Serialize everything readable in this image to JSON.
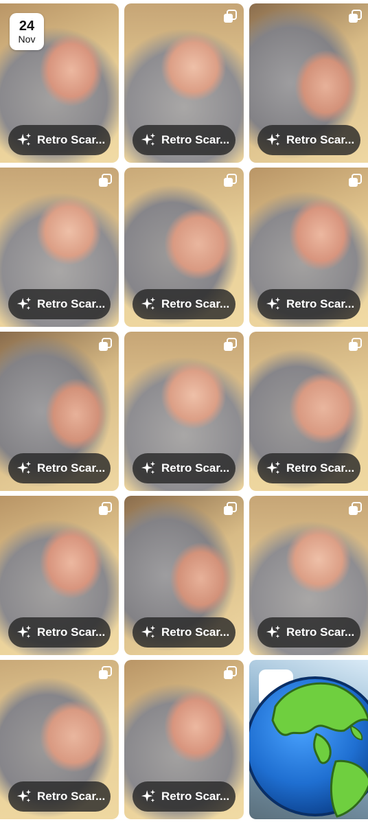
{
  "date_chip": {
    "day": "24",
    "month": "Nov"
  },
  "tiles": [
    {
      "label": "Retro Scar..."
    },
    {
      "label": "Retro Scar..."
    },
    {
      "label": "Retro Scar..."
    },
    {
      "label": "Retro Scar..."
    },
    {
      "label": "Retro Scar..."
    },
    {
      "label": "Retro Scar..."
    },
    {
      "label": "Retro Scar..."
    },
    {
      "label": "Retro Scar..."
    },
    {
      "label": "Retro Scar..."
    },
    {
      "label": "Retro Scar..."
    },
    {
      "label": "Retro Scar..."
    },
    {
      "label": "Retro Scar..."
    },
    {
      "label": "Retro Scar..."
    },
    {
      "label": "Retro Scar..."
    }
  ],
  "icons": {
    "stack": "stack-icon",
    "sparkle": "sparkle-icon",
    "globe": "globe-icon"
  },
  "colors": {
    "badge_bg": "#282828",
    "badge_text": "#ffffff",
    "globe_ocean": "#1f6fd1",
    "globe_land": "#6fcf3f"
  }
}
